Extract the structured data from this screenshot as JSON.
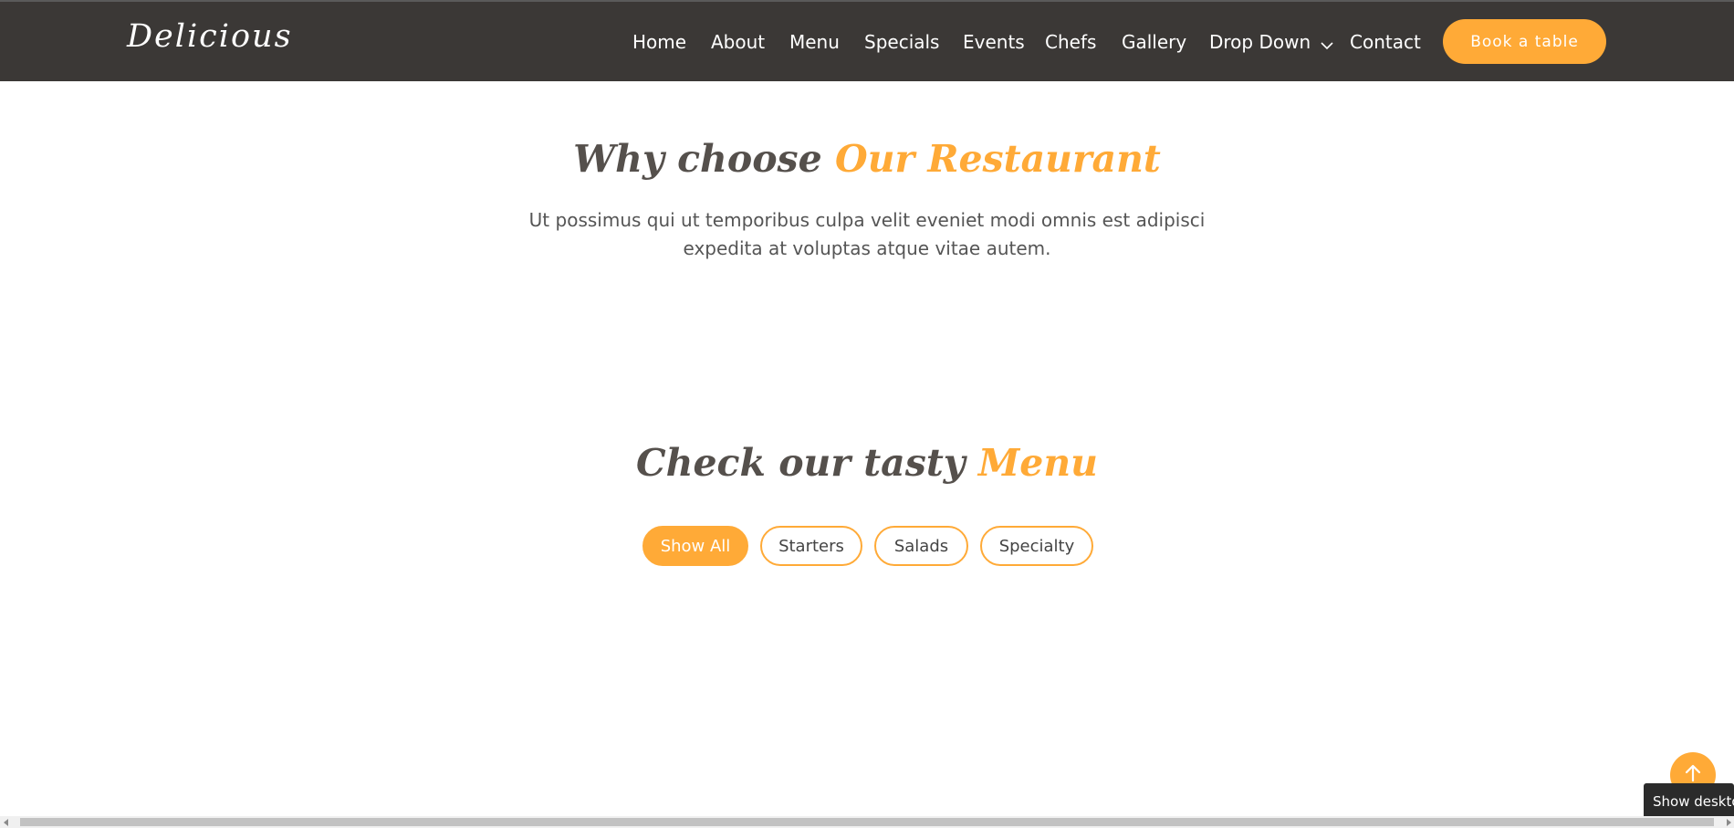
{
  "header": {
    "logo": "Delicious",
    "nav": [
      "Home",
      "About",
      "Menu",
      "Specials",
      "Events",
      "Chefs",
      "Gallery",
      "Drop Down",
      "Contact"
    ],
    "book_label": "Book a table"
  },
  "why": {
    "title_main": "Why choose ",
    "title_accent": "Our Restaurant",
    "text_line1": "Ut possimus qui ut temporibus culpa velit eveniet modi omnis est adipisci",
    "text_line2": "expedita at voluptas atque vitae autem."
  },
  "menu": {
    "title_main": "Check our tasty ",
    "title_accent": "Menu",
    "filters": [
      "Show All",
      "Starters",
      "Salads",
      "Specialty"
    ],
    "active_filter": "Show All"
  },
  "tooltip": "Show desktop",
  "colors": {
    "accent": "#ffaa37",
    "header_bg": "#3b3836",
    "heading": "#55504c"
  },
  "icons": {
    "dropdown": "chevron-down-icon",
    "back_to_top": "arrow-up-icon",
    "scroll_left": "scroll-left-arrow-icon",
    "scroll_right": "scroll-right-arrow-icon"
  }
}
